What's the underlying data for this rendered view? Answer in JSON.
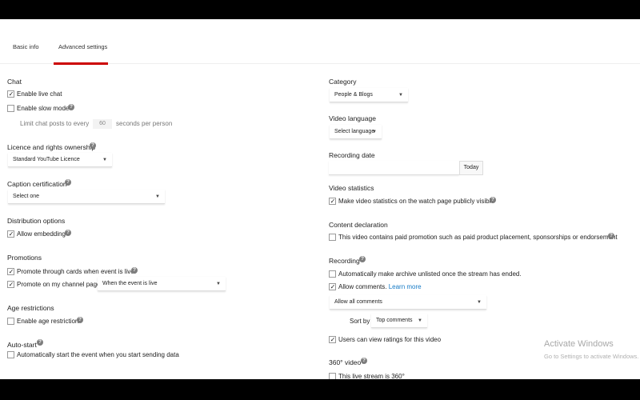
{
  "tabs": {
    "basic": "Basic info",
    "advanced": "Advanced settings"
  },
  "left": {
    "chat": {
      "title": "Chat",
      "live_chat": "Enable live chat",
      "slow_mode": "Enable slow mode",
      "limit_prefix": "Limit chat posts to every",
      "limit_value": "60",
      "limit_suffix": "seconds per person"
    },
    "licence": {
      "title": "Licence and rights ownership",
      "value": "Standard YouTube Licence"
    },
    "caption": {
      "title": "Caption certification",
      "value": "Select one"
    },
    "distribution": {
      "title": "Distribution options",
      "embedding": "Allow embedding"
    },
    "promotions": {
      "title": "Promotions",
      "cards": "Promote through cards when event is live.",
      "channel": "Promote on my channel page",
      "channel_option": "When the event is live"
    },
    "age": {
      "title": "Age restrictions",
      "enable": "Enable age restriction"
    },
    "autostart": {
      "title": "Auto-start",
      "option": "Automatically start the event when you start sending data"
    }
  },
  "right": {
    "category": {
      "title": "Category",
      "value": "People & Blogs"
    },
    "language": {
      "title": "Video language",
      "value": "Select language"
    },
    "recording_date": {
      "title": "Recording date",
      "today": "Today"
    },
    "stats": {
      "title": "Video statistics",
      "option": "Make video statistics on the watch page publicly visible"
    },
    "content": {
      "title": "Content declaration",
      "option": "This video contains paid promotion such as paid product placement, sponsorships or endorsement"
    },
    "recording": {
      "title": "Recording",
      "archive": "Automatically make archive unlisted once the stream has ended.",
      "comments": "Allow comments.",
      "learn_more": "Learn more",
      "comments_value": "Allow all comments",
      "sort_label": "Sort by",
      "sort_value": "Top comments",
      "ratings": "Users can view ratings for this video"
    },
    "video360": {
      "title": "360° video",
      "option": "This live stream is 360°"
    }
  },
  "watermark": {
    "line1": "Activate Windows",
    "line2": "Go to Settings to activate Windows."
  }
}
